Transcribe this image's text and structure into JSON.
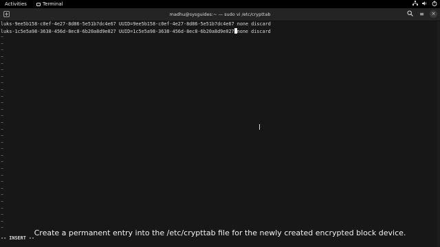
{
  "topbar": {
    "activities": "Activities",
    "app_name": "Terminal",
    "tray_icons": [
      "network-icon",
      "volume-icon",
      "power-icon"
    ]
  },
  "headerbar": {
    "title": "madhu@sysguides:~ — sudo vi /etc/crypttab",
    "new_tab_icon": "+",
    "search_icon": "⚲",
    "menu_icon": "≡",
    "close_icon": "×"
  },
  "editor": {
    "line1": "luks-9ee5b158-c0ef-4e27-8d86-5e51b7dc4e67 UUID=9ee5b158-c0ef-4e27-8d86-5e51b7dc4e67 none discard",
    "line2_before_cursor": "luks-1c5e5a98-3638-456d-8ec8-6b20a8d9e027 UUID=1c5e5a98-3638-456d-8ec8-6b20a8d9e027",
    "line2_after_cursor": "none discard",
    "tilde": "~",
    "mode": "-- INSERT --"
  },
  "caption": "Create a permanent entry into the /etc/crypttab file for the newly created encrypted block device.",
  "colors": {
    "background": "#171717",
    "topbar": "#000000",
    "headerbar": "#242424"
  }
}
